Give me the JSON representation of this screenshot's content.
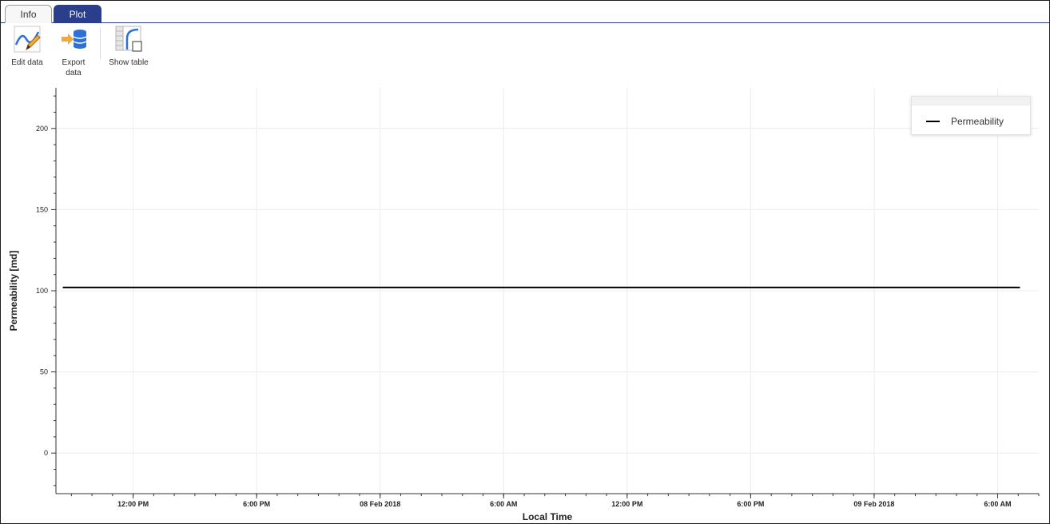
{
  "tabs": [
    {
      "label": "Info",
      "active": false
    },
    {
      "label": "Plot",
      "active": true
    }
  ],
  "toolbar": {
    "edit_label": "Edit data",
    "export_label_line1": "Export",
    "export_label_line2": "data",
    "table_label": "Show table",
    "icons": [
      "edit-data-icon",
      "export-data-icon",
      "show-table-icon"
    ]
  },
  "colors": {
    "accent": "#2b3e8c",
    "series_line": "#000000",
    "gridline": "#ececec"
  },
  "chart_data": {
    "type": "line",
    "xlabel": "Local Time",
    "ylabel": "Permeability [md]",
    "ylim": [
      -25,
      225
    ],
    "yticks": [
      0,
      50,
      100,
      150,
      200
    ],
    "xlim": [
      "2018-02-07T08:15",
      "2018-02-09T08:00"
    ],
    "xticks": [
      {
        "t": "2018-02-07T12:00",
        "label": "12:00 PM"
      },
      {
        "t": "2018-02-07T18:00",
        "label": "6:00 PM"
      },
      {
        "t": "2018-02-08T00:00",
        "label": "08 Feb 2018"
      },
      {
        "t": "2018-02-08T06:00",
        "label": "6:00 AM"
      },
      {
        "t": "2018-02-08T12:00",
        "label": "12:00 PM"
      },
      {
        "t": "2018-02-08T18:00",
        "label": "6:00 PM"
      },
      {
        "t": "2018-02-09T00:00",
        "label": "09 Feb 2018"
      },
      {
        "t": "2018-02-09T06:00",
        "label": "6:00 AM"
      }
    ],
    "series": [
      {
        "name": "Permeability",
        "x": [
          "2018-02-07T08:35",
          "2018-02-09T07:05"
        ],
        "y": [
          102,
          102
        ]
      }
    ],
    "legend": "top-right",
    "grid": true
  }
}
